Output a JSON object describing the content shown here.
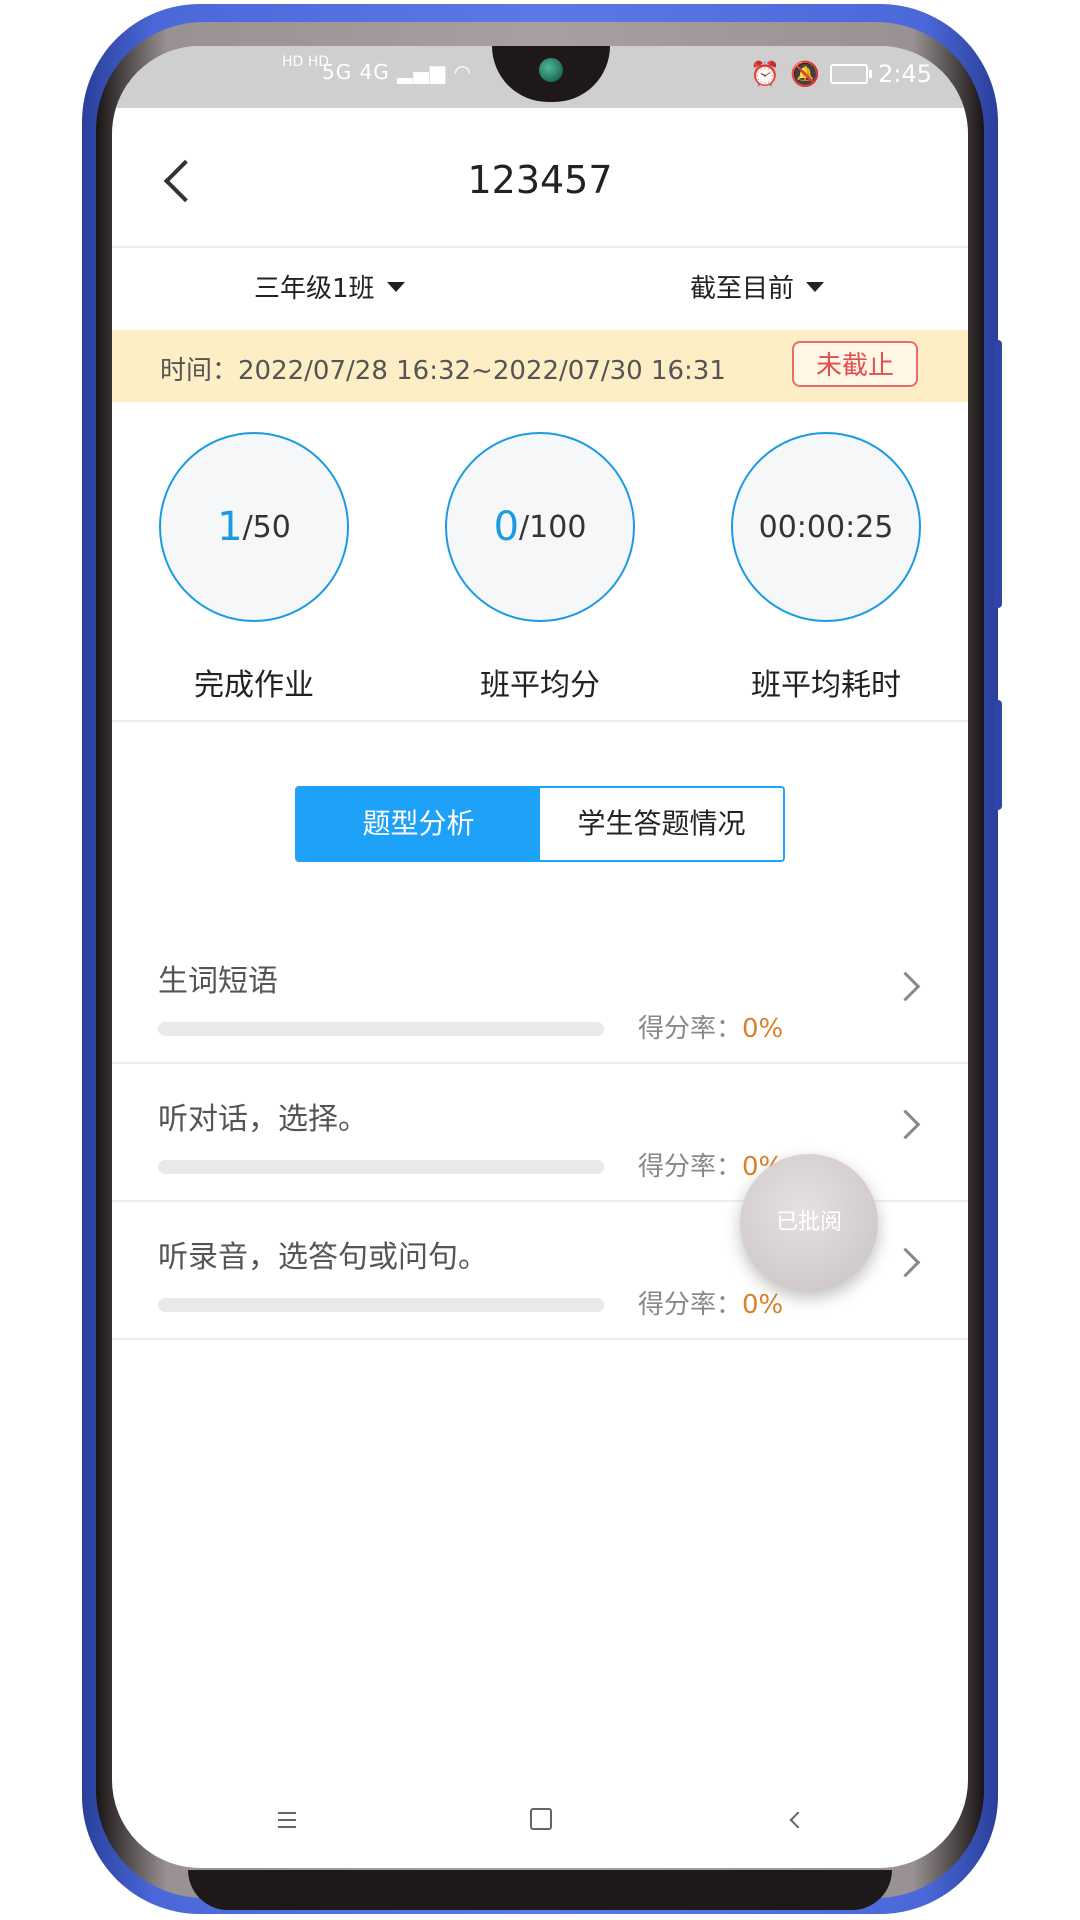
{
  "status_bar": {
    "network_left": "HD HD",
    "signal": "5G 4G",
    "time": "2:45"
  },
  "header": {
    "title": "123457"
  },
  "filters": {
    "class_label": "三年级1班",
    "range_label": "截至目前"
  },
  "time_banner": {
    "text": "时间：2022/07/28 16:32~2022/07/30 16:31",
    "status": "未截止",
    "status_color": "#e24f4f",
    "background": "#fdeec5"
  },
  "stats": [
    {
      "value": "1",
      "total": "/50",
      "label": "完成作业"
    },
    {
      "value": "0",
      "total": "/100",
      "label": "班平均分"
    },
    {
      "value": "00:00:25",
      "total": "",
      "label": "班平均耗时"
    }
  ],
  "tabs": [
    {
      "label": "题型分析",
      "active": true
    },
    {
      "label": "学生答题情况",
      "active": false
    }
  ],
  "rows": [
    {
      "title": "生词短语",
      "score_label": "得分率：",
      "score_value": "0%",
      "progress": 0
    },
    {
      "title": "听对话，选择。",
      "score_label": "得分率：",
      "score_value": "0%",
      "progress": 0
    },
    {
      "title": "听录音，选答句或问句。",
      "score_label": "得分率：",
      "score_value": "0%",
      "progress": 0
    }
  ],
  "floating_button": {
    "label": "已批阅"
  },
  "colors": {
    "accent": "#1ea2f7",
    "score": "#d9822b"
  }
}
